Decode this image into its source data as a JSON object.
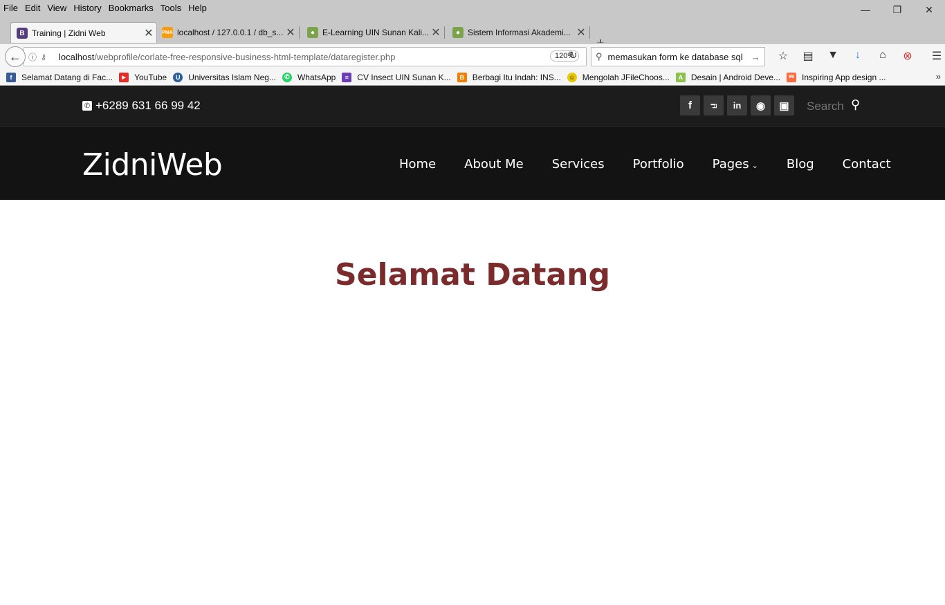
{
  "browser": {
    "menu": [
      "File",
      "Edit",
      "View",
      "History",
      "Bookmarks",
      "Tools",
      "Help"
    ],
    "tabs": [
      {
        "title": "Training | Zidni Web",
        "icon": "bootstrap-icon",
        "active": true
      },
      {
        "title": "localhost / 127.0.0.1 / db_s...",
        "icon": "phpmyadmin-icon"
      },
      {
        "title": "E-Learning UIN Sunan Kali...",
        "icon": "uin-icon"
      },
      {
        "title": "Sistem Informasi Akademi...",
        "icon": "uin-icon"
      }
    ],
    "url_host": "localhost",
    "url_path": "/webprofile/corlate-free-responsive-business-html-template/dataregister.php",
    "zoom": "120%",
    "search_value": "memasukan form ke database sql",
    "bookmarks": [
      {
        "label": "Selamat Datang di Fac...",
        "icon": "facebook-icon",
        "color": "#3b5998",
        "glyph": "f"
      },
      {
        "label": "YouTube",
        "icon": "youtube-icon",
        "color": "#e52d27",
        "glyph": "▶"
      },
      {
        "label": "Universitas Islam Neg...",
        "icon": "uin-logo-icon",
        "color": "#2b5e9c",
        "glyph": "U"
      },
      {
        "label": "WhatsApp",
        "icon": "whatsapp-icon",
        "color": "#25d366",
        "glyph": "✆"
      },
      {
        "label": "CV Insect UIN Sunan K...",
        "icon": "list-icon",
        "color": "#6a3fb5",
        "glyph": "≡"
      },
      {
        "label": "Berbagi Itu Indah: INS...",
        "icon": "blogger-icon",
        "color": "#f57d00",
        "glyph": "B"
      },
      {
        "label": "Mengolah JFileChoos...",
        "icon": "smiley-icon",
        "color": "#e8c800",
        "glyph": "☺"
      },
      {
        "label": "Desain | Android Deve...",
        "icon": "android-icon",
        "color": "#8bc34a",
        "glyph": "A"
      },
      {
        "label": "Inspiring App design ...",
        "icon": "99designs-icon",
        "color": "#ff6b3d",
        "glyph": "99"
      }
    ]
  },
  "site": {
    "phone": "+6289 631 66 99 42",
    "social": [
      {
        "icon": "facebook-icon",
        "glyph": "f"
      },
      {
        "icon": "twitter-icon",
        "glyph": "t"
      },
      {
        "icon": "linkedin-icon",
        "glyph": "in"
      },
      {
        "icon": "github-icon",
        "glyph": "◉"
      },
      {
        "icon": "instagram-icon",
        "glyph": "◘"
      }
    ],
    "search_placeholder": "Search",
    "brand": "ZidniWeb",
    "nav": [
      "Home",
      "About Me",
      "Services",
      "Portfolio",
      "Pages",
      "Blog",
      "Contact"
    ],
    "hero_title": "Selamat Datang",
    "colors": {
      "hero": "#7b2b2b",
      "header_bg": "#131313",
      "topbar_bg": "#1c1c1c"
    }
  }
}
